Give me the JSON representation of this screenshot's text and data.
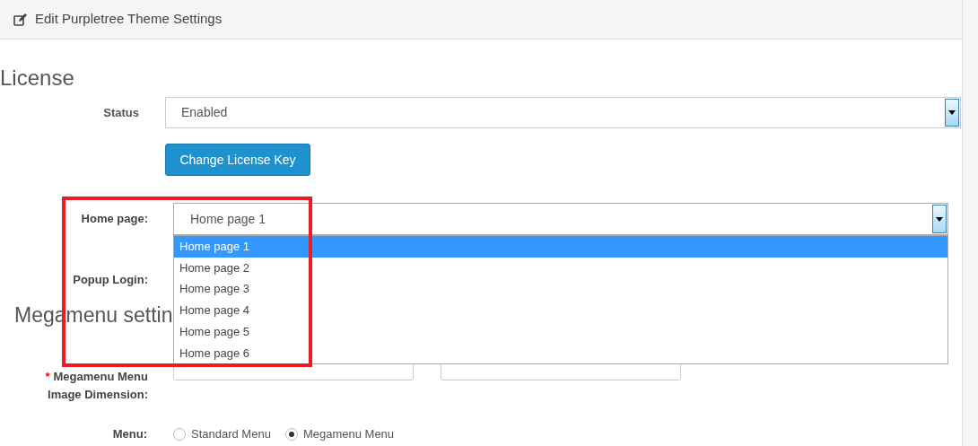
{
  "panel": {
    "title": "Edit Purpletree Theme Settings"
  },
  "license": {
    "heading": "License",
    "status_label": "Status",
    "status_value": "Enabled",
    "button": "Change License Key"
  },
  "home_page": {
    "label": "Home page:",
    "value": "Home page 1",
    "expanded": true,
    "options": [
      {
        "label": "Home page 1",
        "selected": true
      },
      {
        "label": "Home page 2",
        "selected": false
      },
      {
        "label": "Home page 3",
        "selected": false
      },
      {
        "label": "Home page 4",
        "selected": false
      },
      {
        "label": "Home page 5",
        "selected": false
      },
      {
        "label": "Home page 6",
        "selected": false
      }
    ]
  },
  "popup_login": {
    "label": "Popup Login:"
  },
  "megamenu": {
    "heading": "Megamenu settin",
    "required_mark": "*",
    "dimension_label_1": "Megamenu Menu",
    "dimension_label_2": "Image Dimension:",
    "menu_label": "Menu:",
    "menu_options": [
      {
        "label": "Standard Menu",
        "selected": false
      },
      {
        "label": "Megamenu Menu",
        "selected": true
      }
    ]
  },
  "annotation": {
    "shown": true
  }
}
